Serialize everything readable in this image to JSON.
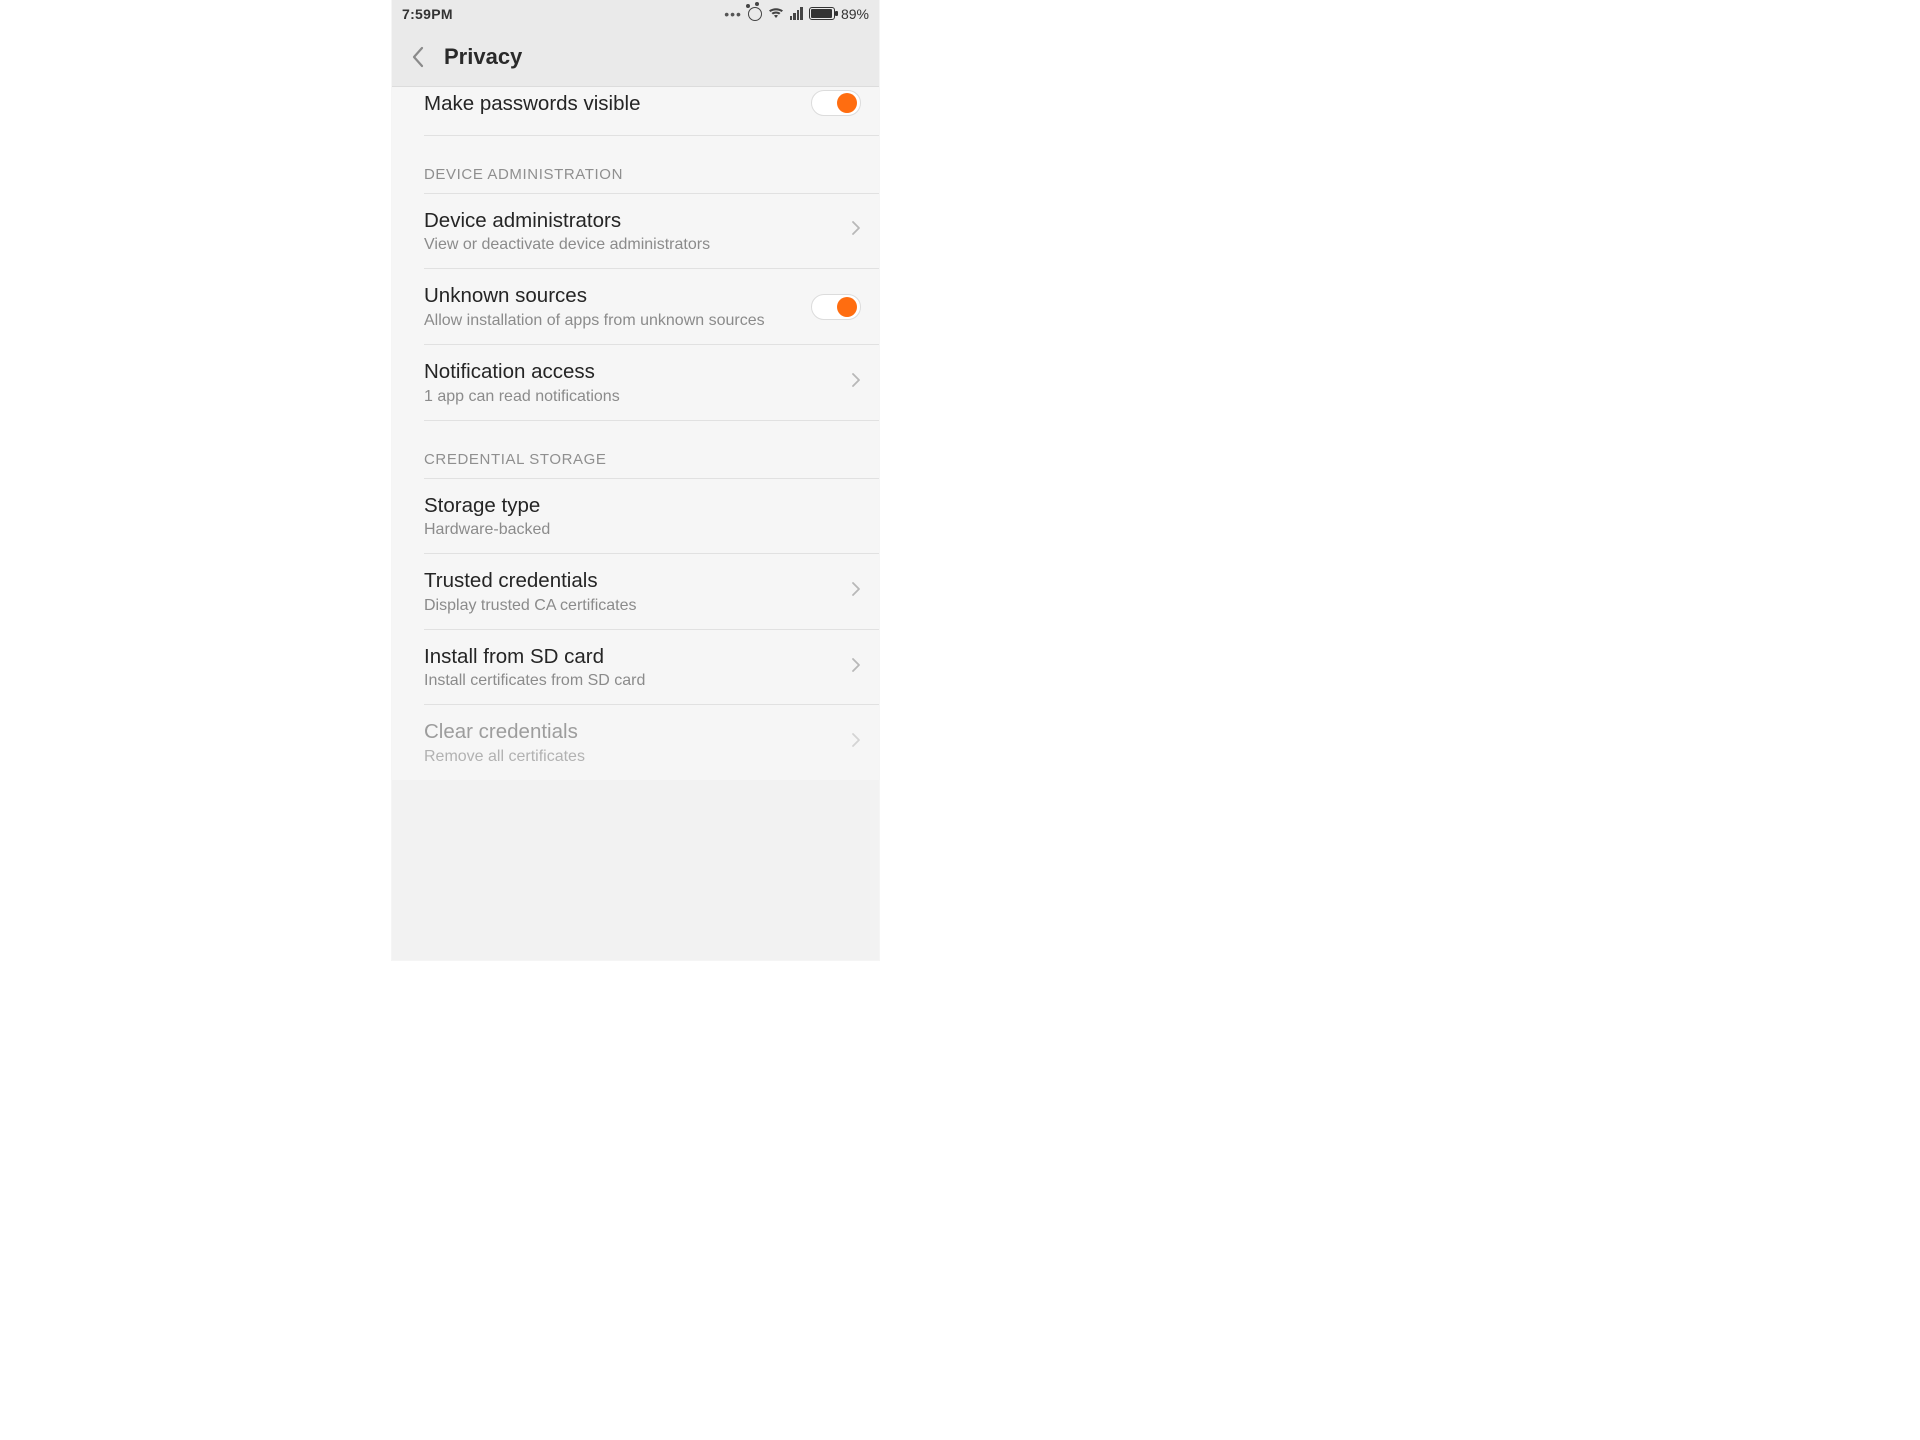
{
  "statusbar": {
    "time": "7:59PM",
    "battery_pct": "89%"
  },
  "header": {
    "title": "Privacy"
  },
  "rows": {
    "passwords": {
      "title": "Make passwords visible"
    },
    "device_admins": {
      "title": "Device administrators",
      "sub": "View or deactivate device administrators"
    },
    "unknown": {
      "title": "Unknown sources",
      "sub": "Allow installation of apps from unknown sources"
    },
    "notif": {
      "title": "Notification access",
      "sub": "1 app can read notifications"
    },
    "storage_type": {
      "title": "Storage type",
      "sub": "Hardware-backed"
    },
    "trusted": {
      "title": "Trusted credentials",
      "sub": "Display trusted CA certificates"
    },
    "install_sd": {
      "title": "Install from SD card",
      "sub": "Install certificates from SD card"
    },
    "clear_creds": {
      "title": "Clear credentials",
      "sub": "Remove all certificates"
    }
  },
  "sections": {
    "device_admin": "DEVICE ADMINISTRATION",
    "cred_storage": "CREDENTIAL STORAGE"
  },
  "toggles": {
    "passwords_visible": true,
    "unknown_sources": true
  },
  "colors": {
    "accent": "#ff6d10"
  }
}
